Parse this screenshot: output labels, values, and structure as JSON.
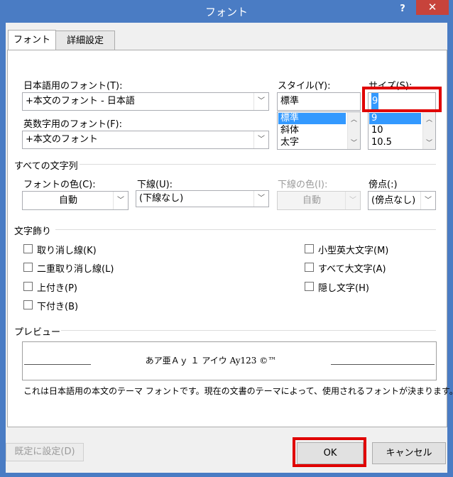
{
  "window": {
    "title": "フォント",
    "help": "?",
    "close": "✕"
  },
  "tabs": [
    {
      "label": "フォント"
    },
    {
      "label": "詳細設定"
    }
  ],
  "fonts": {
    "jp_label": "日本語用のフォント(T):",
    "jp_value": "+本文のフォント - 日本語",
    "en_label": "英数字用のフォント(F):",
    "en_value": "+本文のフォント"
  },
  "style": {
    "label": "スタイル(Y):",
    "value": "標準",
    "options": [
      "標準",
      "斜体",
      "太字"
    ]
  },
  "size": {
    "label": "サイズ(S):",
    "value": "9",
    "options": [
      "9",
      "10",
      "10.5"
    ]
  },
  "all_text": {
    "group_label": "すべての文字列",
    "color_label": "フォントの色(C):",
    "color_value": "自動",
    "underline_label": "下線(U):",
    "underline_value": "(下線なし)",
    "underline_color_label": "下線の色(I):",
    "underline_color_value": "自動",
    "emphasis_label": "傍点(:)",
    "emphasis_value": "(傍点なし)"
  },
  "effects": {
    "group_label": "文字飾り",
    "left": [
      "取り消し線(K)",
      "二重取り消し線(L)",
      "上付き(P)",
      "下付き(B)"
    ],
    "right": [
      "小型英大文字(M)",
      "すべて大文字(A)",
      "隠し文字(H)"
    ]
  },
  "preview": {
    "group_label": "プレビュー",
    "sample": "あア亜Ａｙ １ アイウ Ay123 ©™",
    "description": "これは日本語用の本文のテーマ フォントです。現在の文書のテーマによって、使用されるフォントが決まります。"
  },
  "buttons": {
    "default": "既定に設定(D)",
    "ok": "OK",
    "cancel": "キャンセル"
  },
  "colors": {
    "titlebar": "#4a7cc4",
    "close": "#c7433b",
    "highlight": "#e00000",
    "selection": "#3399ff"
  }
}
